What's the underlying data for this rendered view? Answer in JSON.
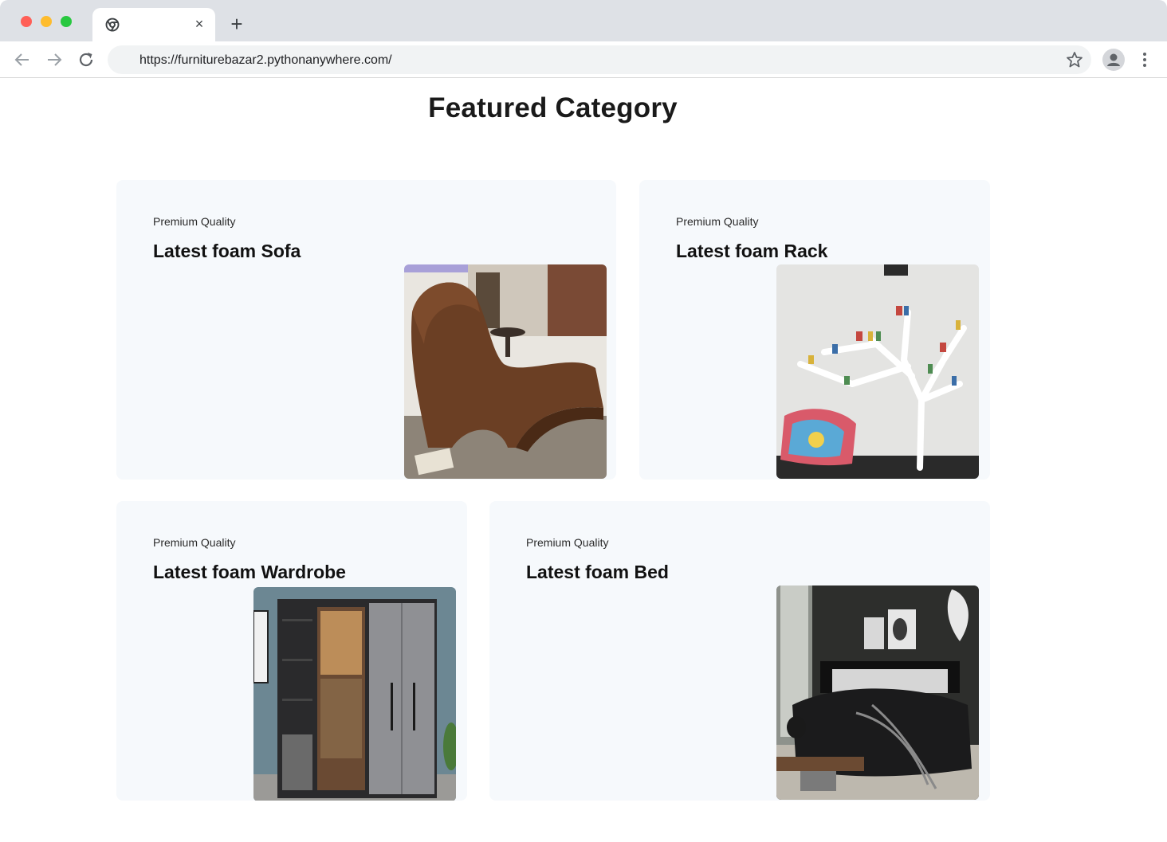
{
  "browser": {
    "tab_close": "×",
    "new_tab": "+",
    "url": "https://furniturebazar2.pythonanywhere.com/",
    "icons": {
      "back": "arrow-left-icon",
      "forward": "arrow-right-icon",
      "reload": "reload-icon",
      "bookmark": "star-icon",
      "profile": "profile-icon",
      "menu": "kebab-menu-icon",
      "favicon": "chrome-icon"
    }
  },
  "page": {
    "title": "Featured Category",
    "categories": [
      {
        "kicker": "Premium Quality",
        "name": "Latest foam Sofa",
        "image": "sofa-image"
      },
      {
        "kicker": "Premium Quality",
        "name": "Latest foam Rack",
        "image": "tree-bookshelf-image"
      },
      {
        "kicker": "Premium Quality",
        "name": "Latest foam Wardrobe",
        "image": "wardrobe-image"
      },
      {
        "kicker": "Premium Quality",
        "name": "Latest foam Bed",
        "image": "bedroom-image"
      }
    ]
  }
}
